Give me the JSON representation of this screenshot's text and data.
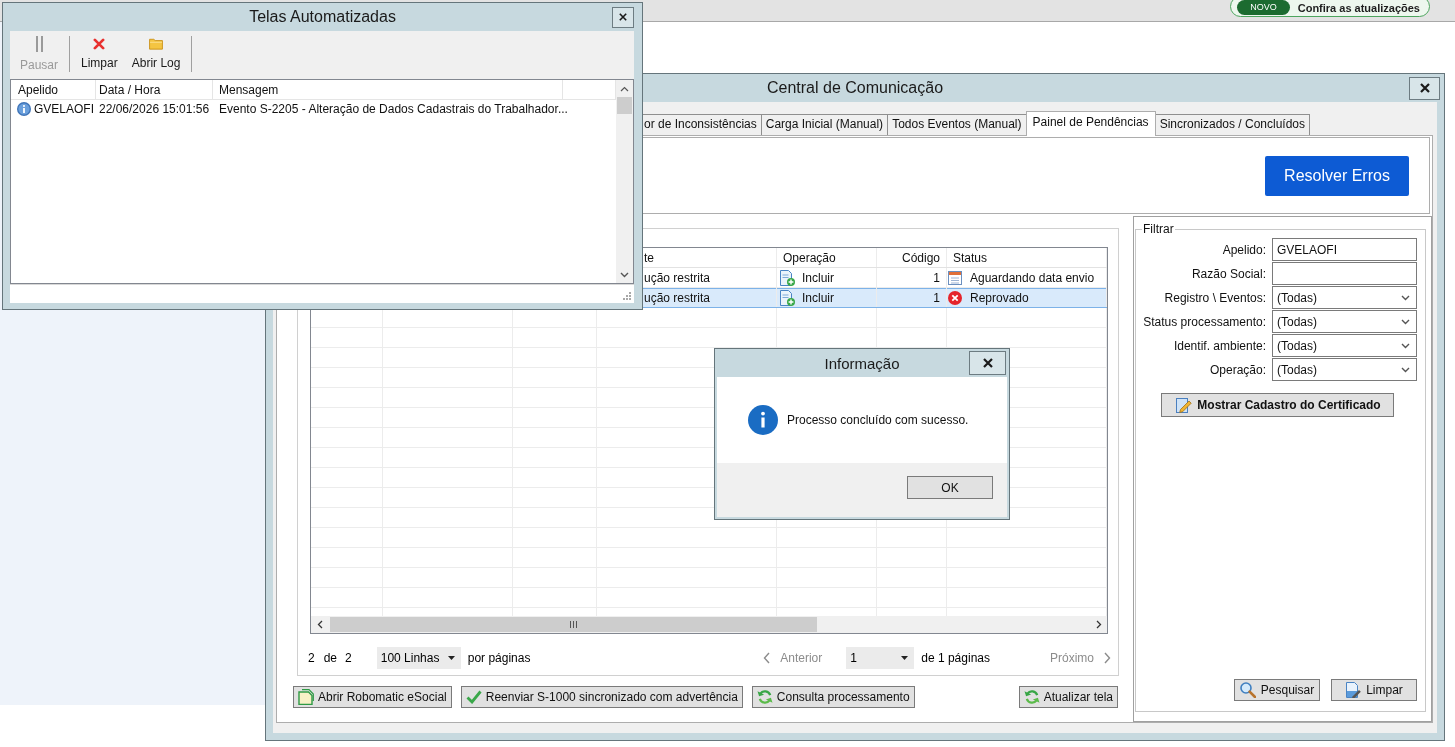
{
  "top_bar": {
    "update_notice": {
      "badge": "NOVO",
      "text": "Confira as atualizações"
    }
  },
  "automation_window": {
    "title": "Telas Automatizadas",
    "toolbar": [
      {
        "kind": "pause",
        "label": "Pausar",
        "disabled": true
      },
      {
        "kind": "clear",
        "label": "Limpar",
        "disabled": false
      },
      {
        "kind": "folder",
        "label": "Abrir Log",
        "disabled": false
      }
    ],
    "columns": [
      "Apelido",
      "Data / Hora",
      "Mensagem"
    ],
    "rows": [
      {
        "kind": "info",
        "cells": [
          "GVELAOFI",
          "22/06/2026 15:01:56",
          "Evento S-2205 - Alteração de Dados Cadastrais do Trabalhador..."
        ]
      }
    ]
  },
  "main_window": {
    "title": "Central de Comunicação",
    "tabs": [
      {
        "label": "or de Inconsistências",
        "selected": false
      },
      {
        "label": "Carga Inicial (Manual)",
        "selected": false
      },
      {
        "label": "Todos Eventos (Manual)",
        "selected": false
      },
      {
        "label": "Painel de Pendências",
        "selected": true
      },
      {
        "label": "Sincronizados / Concluídos",
        "selected": false
      }
    ],
    "resolve_button": "Resolver Erros",
    "grid": {
      "columns": [
        "te",
        "Operação",
        "Código",
        "Status"
      ],
      "rows": [
        {
          "selected": false,
          "kind": "scheduled",
          "cells": [
            "ução restrita",
            "Incluir",
            "1",
            "Aguardando data envio"
          ]
        },
        {
          "selected": true,
          "kind": "error",
          "cells": [
            "ução restrita",
            "Incluir",
            "1",
            "Reprovado"
          ]
        }
      ]
    },
    "pager": {
      "count": "2",
      "of": "de",
      "total": "2",
      "page_size": "100 Linhas",
      "page_size_suffix": "por páginas",
      "previous": {
        "label": "Anterior",
        "disabled": true
      },
      "page": "1",
      "page_total": "de 1 páginas",
      "next": {
        "label": "Próximo",
        "disabled": true
      }
    },
    "actions": [
      {
        "kind": "open",
        "label": "Abrir Robomatic eSocial"
      },
      {
        "kind": "check",
        "label": "Reenviar S-1000 sincronizado com advertência"
      },
      {
        "kind": "refresh",
        "label": "Consulta processamento"
      }
    ],
    "refresh_button": {
      "kind": "refresh",
      "label": "Atualizar tela"
    },
    "filter": {
      "title": "Filtrar",
      "fields": [
        {
          "label": "Apelido:",
          "kind": "text",
          "value": "GVELAOFI"
        },
        {
          "label": "Razão Social:",
          "kind": "text"
        },
        {
          "label": "Registro \\ Eventos:",
          "kind": "select",
          "value": "(Todas)"
        },
        {
          "label": "Status processamento:",
          "kind": "select",
          "value": "(Todas)"
        },
        {
          "label": "Identif. ambiente:",
          "kind": "select",
          "value": "(Todas)"
        },
        {
          "label": "Operação:",
          "kind": "select",
          "value": "(Todas)"
        }
      ],
      "certificate_button": "Mostrar Cadastro do Certificado",
      "buttons": [
        {
          "kind": "search",
          "label": "Pesquisar"
        },
        {
          "kind": "clear",
          "label": "Limpar"
        }
      ]
    }
  },
  "dialog": {
    "title": "Informação",
    "kind": "info",
    "message": "Processo concluído com sucesso.",
    "button": "OK"
  }
}
